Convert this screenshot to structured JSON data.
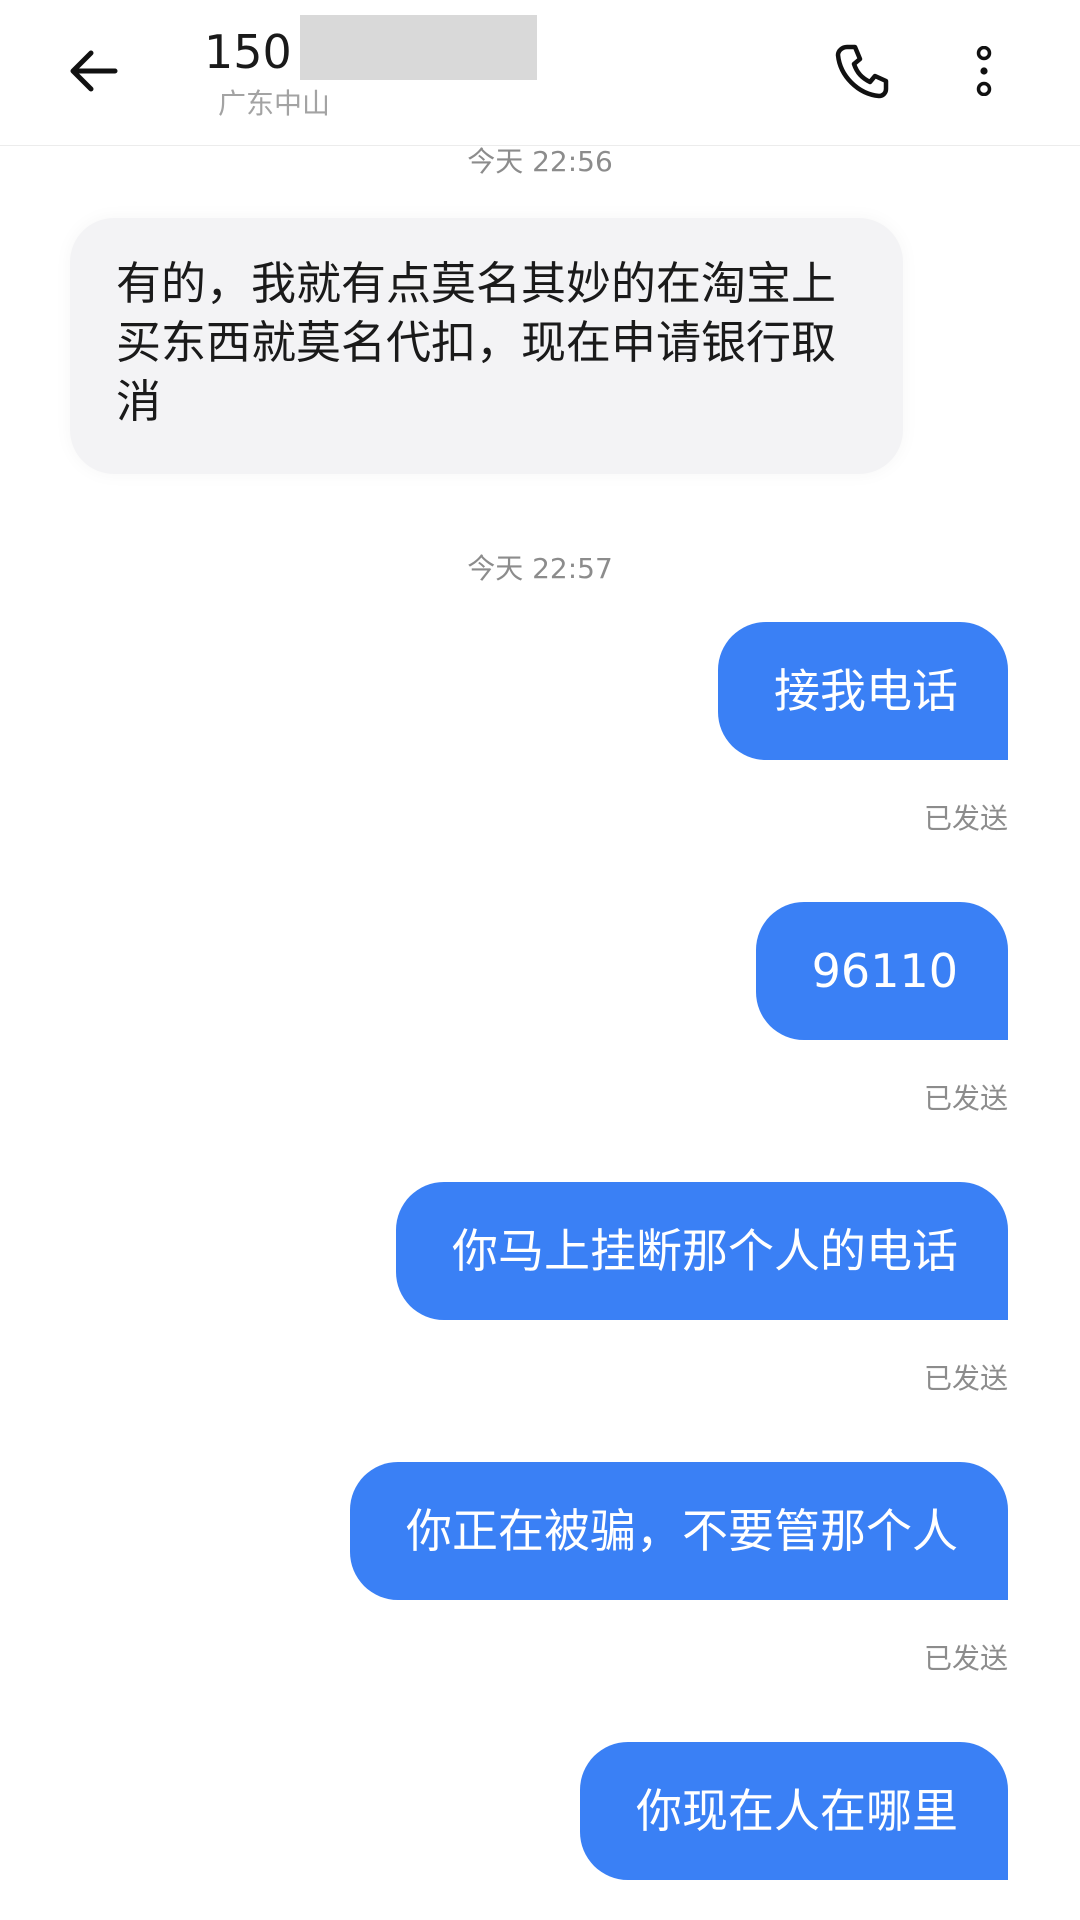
{
  "header": {
    "title": "150",
    "subtitle": "广东中山"
  },
  "messages": [
    {
      "type": "time",
      "text": "今天 22:56"
    },
    {
      "type": "incoming",
      "text": "有的，我就有点莫名其妙的在淘宝上买东西就莫名代扣，现在申请银行取消"
    },
    {
      "type": "time",
      "text": "今天 22:57"
    },
    {
      "type": "outgoing",
      "text": "接我电话",
      "status": "已发送"
    },
    {
      "type": "outgoing",
      "text": "96110",
      "status": "已发送"
    },
    {
      "type": "outgoing",
      "text": "你马上挂断那个人的电话",
      "status": "已发送"
    },
    {
      "type": "outgoing",
      "text": "你正在被骗，不要管那个人",
      "status": "已发送"
    },
    {
      "type": "outgoing",
      "text": "你现在人在哪里"
    }
  ],
  "colors": {
    "outgoing_bubble": "#3a80f5",
    "incoming_bubble": "#f3f3f5",
    "meta_text": "#8c8c8c"
  },
  "icons": {
    "back": "back-arrow-icon",
    "call": "phone-icon",
    "more": "more-vertical-icon"
  }
}
